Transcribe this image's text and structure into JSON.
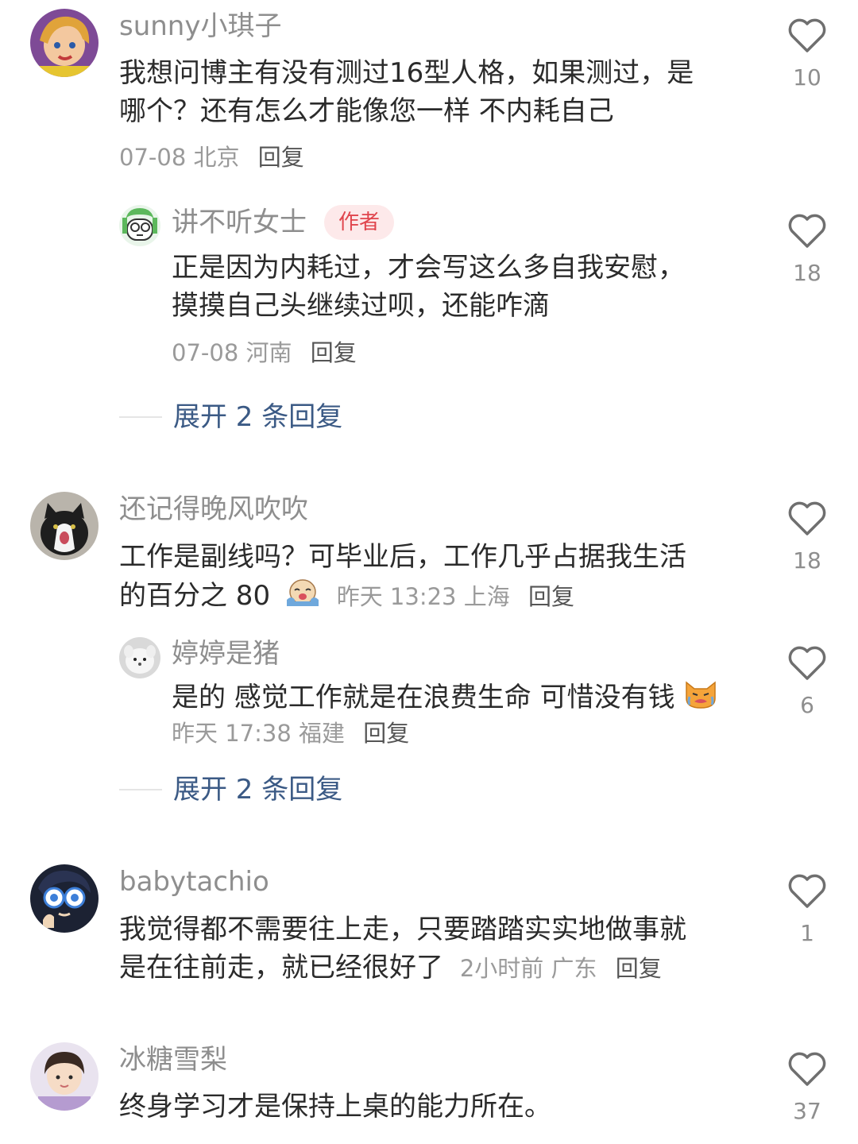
{
  "comments": [
    {
      "user": "sunny小琪子",
      "text_line1": "我想问博主有没有测过16型人格，如果测过，是",
      "text_line2": "哪个？还有怎么才能像您一样 不内耗自己",
      "date": "07-08",
      "location": "北京",
      "reply_label": "回复",
      "likes": "10",
      "replies": [
        {
          "user": "讲不听女士",
          "badge": "作者",
          "text_line1": "正是因为内耗过，才会写这么多自我安慰，",
          "text_line2": "摸摸自己头继续过呗，还能咋滴",
          "date": "07-08",
          "location": "河南",
          "reply_label": "回复",
          "likes": "18"
        }
      ],
      "expand_label": "展开 2 条回复"
    },
    {
      "user": "还记得晚风吹吹",
      "text_line1": "工作是副线吗？可毕业后，工作几乎占据我生活",
      "text_line2": "的百分之 80",
      "date": "昨天 13:23",
      "location": "上海",
      "reply_label": "回复",
      "likes": "18",
      "replies": [
        {
          "user": "婷婷是猪",
          "text_line1": "是的 感觉工作就是在浪费生命 可惜没有钱",
          "date": "昨天 17:38",
          "location": "福建",
          "reply_label": "回复",
          "likes": "6"
        }
      ],
      "expand_label": "展开 2 条回复"
    },
    {
      "user": "babytachio",
      "text_line1": "我觉得都不需要往上走，只要踏踏实实地做事就",
      "text_line2": "是在往前走，就已经很好了",
      "date": "2小时前",
      "location": "广东",
      "reply_label": "回复",
      "likes": "1"
    },
    {
      "user": "冰糖雪梨",
      "text_line1": "终身学习才是保持上桌的能力所在。",
      "likes": "37"
    }
  ],
  "colors": {
    "name": "#8e8e8e",
    "text": "#2b2b2b",
    "meta": "#9a9a9a",
    "expand_link": "#3b5a85",
    "author_badge_bg": "#fde9ea",
    "author_badge_text": "#e0454d"
  },
  "icons": {
    "like": "heart-outline-icon",
    "emoji_crying": "crying-face-emoji",
    "emoji_cat": "crying-cat-emoji"
  }
}
